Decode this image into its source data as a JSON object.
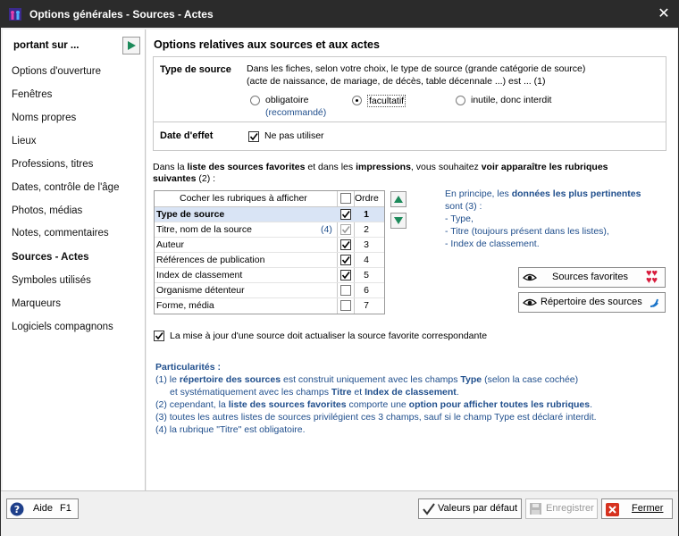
{
  "window": {
    "title": "Options générales - Sources - Actes",
    "close_glyph": "✕"
  },
  "sidebar": {
    "header": "portant sur ...",
    "items": [
      {
        "label": "Options d'ouverture"
      },
      {
        "label": "Fenêtres"
      },
      {
        "label": "Noms propres"
      },
      {
        "label": "Lieux"
      },
      {
        "label": "Professions, titres"
      },
      {
        "label": "Dates, contrôle de l'âge"
      },
      {
        "label": "Photos, médias"
      },
      {
        "label": "Notes, commentaires"
      },
      {
        "label": "Sources - Actes"
      },
      {
        "label": "Symboles utilisés"
      },
      {
        "label": "Marqueurs"
      },
      {
        "label": "Logiciels compagnons"
      }
    ],
    "active_index": 8
  },
  "main": {
    "title": "Options relatives aux sources et aux actes",
    "type_source": {
      "label": "Type de source",
      "desc1": "Dans les fiches, selon votre choix, le type de source (grande catégorie de source)",
      "desc2": "(acte de naissance, de mariage, de décès, table décennale ...)  est ... (1)",
      "opt1": "obligatoire",
      "opt1_note": "(recommandé)",
      "opt2": "facultatif",
      "opt3": "inutile, donc interdit",
      "selected": "facultatif"
    },
    "date_effet": {
      "label": "Date d'effet",
      "check_label": "Ne pas utiliser",
      "checked": true
    },
    "intro_a": "Dans la ",
    "intro_b": "liste des sources favorites",
    "intro_c": " et dans les ",
    "intro_d": "impressions",
    "intro_e": ", vous souhaitez ",
    "intro_f": "voir apparaître les rubriques",
    "intro_g": "suivantes",
    "intro_h": " (2) :",
    "table": {
      "col_label": "Cocher les rubriques à afficher",
      "col_order": "Ordre",
      "rows": [
        {
          "label": "Type de source",
          "note": "",
          "order": "1",
          "checked": true,
          "selected": true
        },
        {
          "label": "Titre, nom de la source",
          "note": "(4)",
          "order": "2",
          "checked": true,
          "selected": false
        },
        {
          "label": "Auteur",
          "note": "",
          "order": "3",
          "checked": true,
          "selected": false
        },
        {
          "label": "Références de publication",
          "note": "",
          "order": "4",
          "checked": true,
          "selected": false
        },
        {
          "label": "Index de classement",
          "note": "",
          "order": "5",
          "checked": true,
          "selected": false
        },
        {
          "label": "Organisme détenteur",
          "note": "",
          "order": "6",
          "checked": false,
          "selected": false
        },
        {
          "label": "Forme, média",
          "note": "",
          "order": "7",
          "checked": false,
          "selected": false
        }
      ]
    },
    "hint": {
      "l1a": "En principe, les ",
      "l1b": "données les plus pertinentes",
      "l2": "sont (3) :",
      "l3": "- Type,",
      "l4": "- Titre (toujours présent dans les listes),",
      "l5": "- Index de classement."
    },
    "buttons": {
      "favorites": "Sources favorites",
      "repertoire": "Répertoire des sources"
    },
    "update_check": {
      "label": "La mise à jour d'une source doit actualiser la source favorite correspondante",
      "checked": true
    },
    "notes": {
      "title": "Particularités :",
      "n1a": "(1) le ",
      "n1b": "répertoire des sources",
      "n1c": " est construit uniquement avec les champs ",
      "n1d": "Type",
      "n1e": " (selon la case cochée)",
      "n1f": "et systématiquement avec les champs ",
      "n1g": "Titre",
      "n1h": " et ",
      "n1i": "Index de classement",
      "n1j": ".",
      "n2a": "(2) cependant, la ",
      "n2b": "liste des sources favorites",
      "n2c": " comporte une ",
      "n2d": "option pour afficher toutes les rubriques",
      "n2e": ".",
      "n3": "(3) toutes les autres listes de sources privilégient ces 3 champs, sauf si le champ Type est déclaré interdit.",
      "n4": "(4) la rubrique \"Titre\" est obligatoire."
    }
  },
  "footer": {
    "help": "Aide",
    "help_key": "F1",
    "defaults": "Valeurs par défaut",
    "save": "Enregistrer",
    "close": "Fermer"
  }
}
